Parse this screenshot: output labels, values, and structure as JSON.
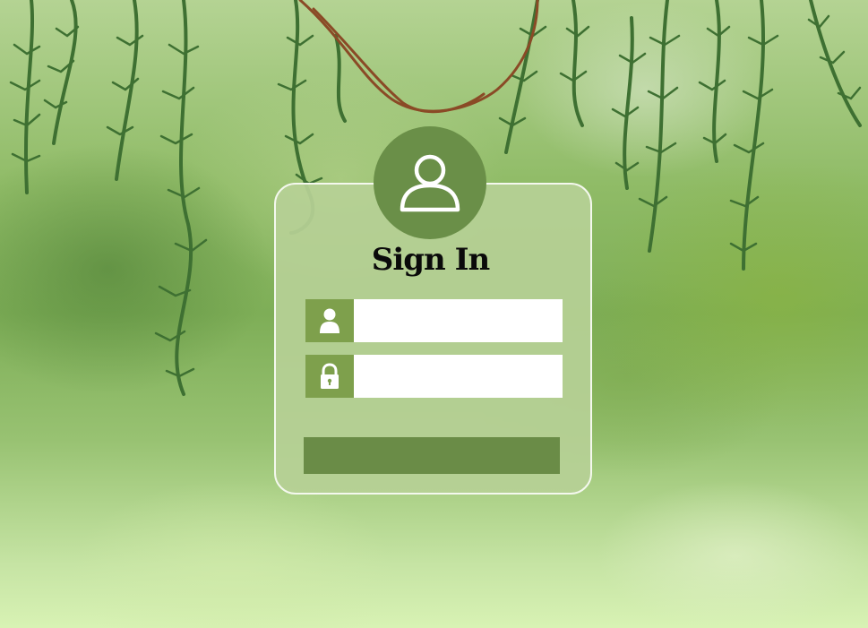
{
  "login": {
    "title": "Sign In",
    "username": {
      "value": "",
      "placeholder": ""
    },
    "password": {
      "value": "",
      "placeholder": ""
    },
    "submit_label": ""
  },
  "icons": {
    "avatar": "user-outline-icon",
    "username_field": "user-icon",
    "password_field": "lock-icon"
  },
  "colors": {
    "accent": "#6a8f48",
    "field_icon_bg": "#7ea04c",
    "card_bg": "#b6d096",
    "vine": "#3e7032",
    "branch": "#8a4a26"
  }
}
